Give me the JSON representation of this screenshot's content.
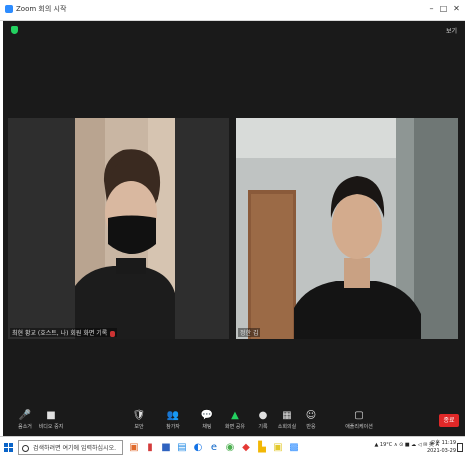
{
  "window": {
    "title": "Zoom 회의 시작",
    "minimize": "–",
    "maximize": "□",
    "close": "✕",
    "view_button": "보기"
  },
  "participants": [
    {
      "name": "최현 황교 (호스트, 나) 회원 화면 기록"
    },
    {
      "name": "정한 김"
    }
  ],
  "toolbar": {
    "buttons": [
      {
        "icon": "🎤",
        "label": "음소거"
      },
      {
        "icon": "■",
        "label": "비디오 중지"
      },
      {
        "icon": "🛡",
        "label": "보안"
      },
      {
        "icon": "👥",
        "label": "참가자"
      },
      {
        "icon": "💬",
        "label": "채팅"
      },
      {
        "icon": "▲",
        "label": "화면 공유"
      },
      {
        "icon": "●",
        "label": "기록"
      },
      {
        "icon": "▦",
        "label": "소회의실"
      },
      {
        "icon": "☺",
        "label": "반응"
      },
      {
        "icon": "▢",
        "label": "애플리케이션"
      }
    ],
    "end": "종료"
  },
  "taskbar": {
    "search_placeholder": "검색하려면 여기에 입력하십시오.",
    "apps": [
      {
        "icon": "▣",
        "color": "#e06a2c"
      },
      {
        "icon": "▮",
        "color": "#d43c3c"
      },
      {
        "icon": "■",
        "color": "#2f63c0"
      },
      {
        "icon": "▤",
        "color": "#1e88e5"
      },
      {
        "icon": "◐",
        "color": "#1473e6"
      },
      {
        "icon": "e",
        "color": "#0a64c8"
      },
      {
        "icon": "◉",
        "color": "#4caf50"
      },
      {
        "icon": "◆",
        "color": "#e53935"
      },
      {
        "icon": "▙",
        "color": "#f2b705"
      },
      {
        "icon": "▣",
        "color": "#e2c82a"
      },
      {
        "icon": "▩",
        "color": "#2d8cff"
      }
    ],
    "tray_text": "▲ 19°C ∧ ⊙ ■ ☁ ◁ ✉ 英 A",
    "time": "오후 11:19",
    "date": "2021-03-29"
  },
  "colors": {
    "meeting_bg": "#1a1a1a",
    "end_button": "#e02828",
    "accent": "#2d8cff",
    "security_icon": "#23d160"
  }
}
